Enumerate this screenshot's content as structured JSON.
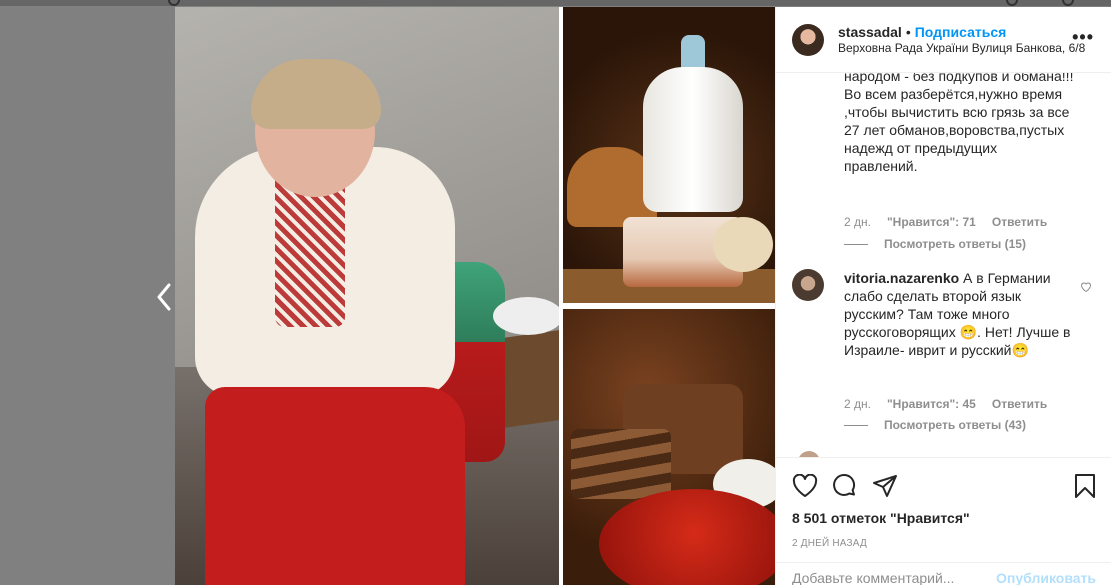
{
  "post": {
    "username": "stassadal",
    "follow_label": "Подписаться",
    "location": "Верховна Рада України Вулиця Банкова, 6/8",
    "more_label": "•••"
  },
  "comments": [
    {
      "text": "народом - без подкупов и обмана!!! Во всем разберётся,нужно время ,чтобы вычистить всю грязь за все 27 лет обманов,воровства,пустых надежд от предыдущих правлений.",
      "time": "2 дн.",
      "likes": "\"Нравится\": 71",
      "reply": "Ответить",
      "view_replies": "Посмотреть ответы (15)"
    },
    {
      "username": "vitoria.nazarenko",
      "text": "А в Германии слабо сделать второй язык русским? Там тоже много русскоговорящих 😁. Нет! Лучше в Израиле- иврит и русский😁",
      "time": "2 дн.",
      "likes": "\"Нравится\": 45",
      "reply": "Ответить",
      "view_replies": "Посмотреть ответы (43)"
    }
  ],
  "actions": {
    "likes_count": "8 501 отметок \"Нравится\"",
    "time_ago": "2 ДНЕЙ НАЗАД",
    "comment_placeholder": "Добавьте комментарий...",
    "publish_label": "Опубликовать"
  },
  "icons": [
    "chevron-left-icon",
    "heart-icon",
    "comment-icon",
    "share-icon",
    "bookmark-icon",
    "small-heart-icon"
  ]
}
